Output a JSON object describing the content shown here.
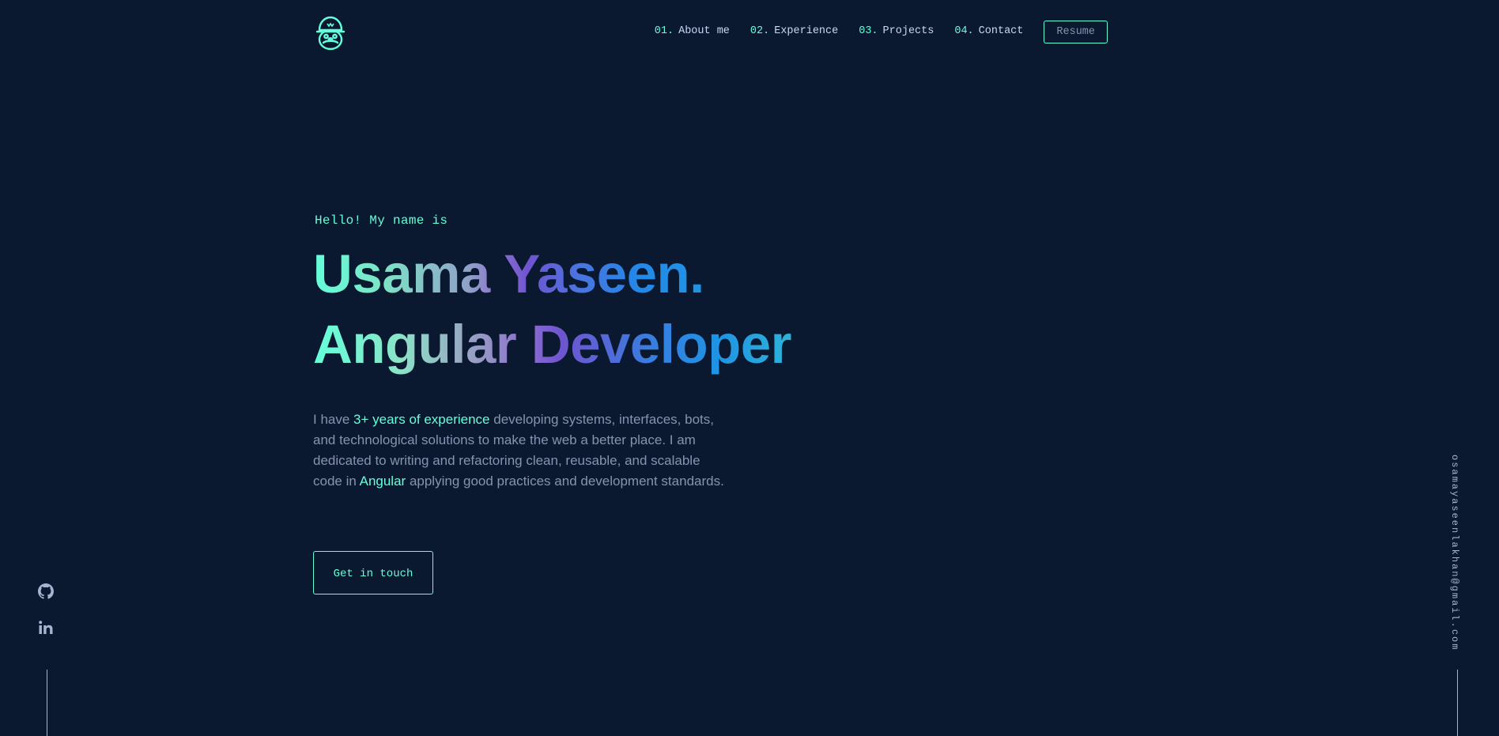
{
  "header": {
    "logo_icon": "mario-avatar-icon",
    "nav": [
      {
        "num": "01.",
        "label": "About me"
      },
      {
        "num": "02.",
        "label": "Experience"
      },
      {
        "num": "03.",
        "label": "Projects"
      },
      {
        "num": "04.",
        "label": "Contact"
      }
    ],
    "resume_label": "Resume"
  },
  "hero": {
    "greeting": "Hello! My name is",
    "name": "Usama Yaseen.",
    "role": "Angular Developer",
    "description": {
      "p1": "I have ",
      "highlight1": "3+ years of experience",
      "p2": " developing systems, interfaces, bots, and technological solutions to make the web a better place. I am dedicated to writing and refactoring clean, reusable, and scalable code in ",
      "highlight2": "Angular",
      "p3": " applying good practices and development standards."
    },
    "cta_label": "Get in touch"
  },
  "social": {
    "icons": [
      "github-icon",
      "linkedin-icon"
    ]
  },
  "email": "osamayaseenlakhan@gmail.com",
  "colors": {
    "background": "#0a192f",
    "accent": "#64ffda",
    "text": "#8892b0",
    "text_light": "#ccd6f6"
  }
}
